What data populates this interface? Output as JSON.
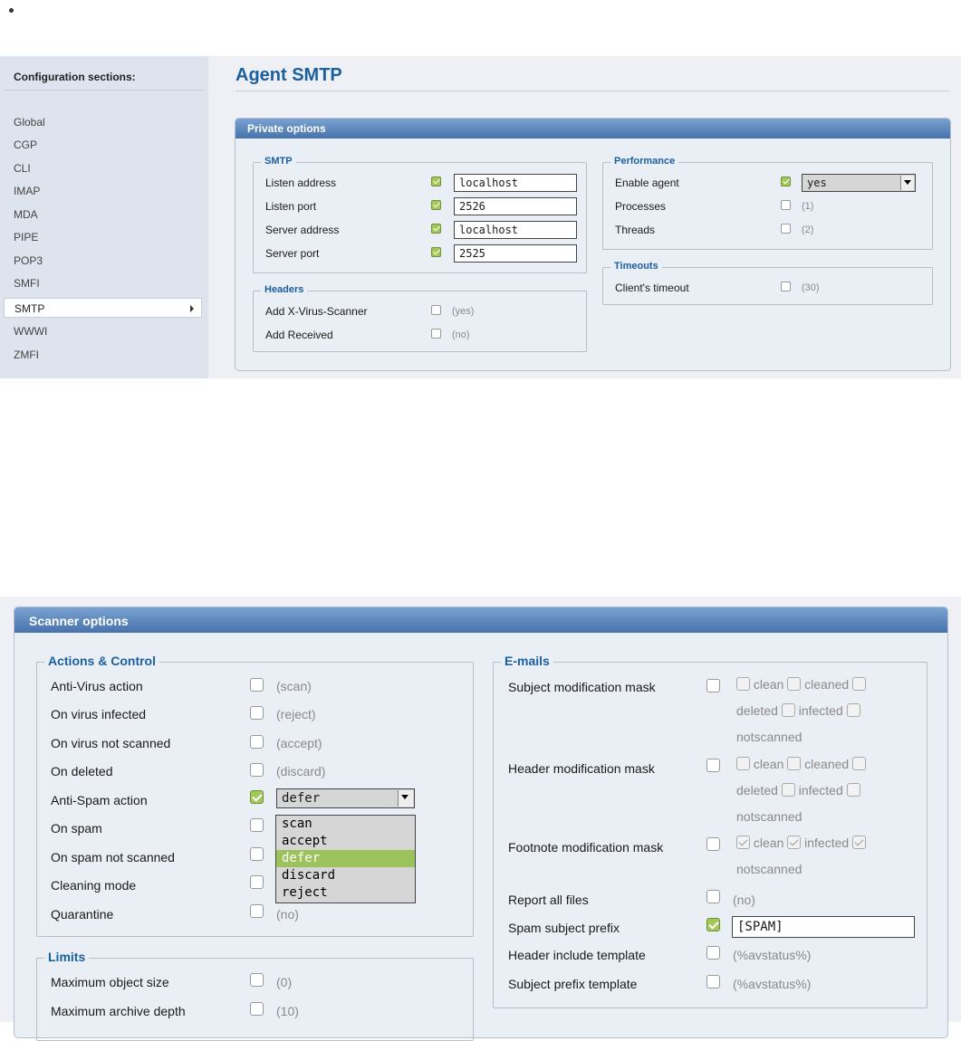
{
  "sidebar": {
    "title": "Configuration sections:",
    "items": [
      "Global",
      "CGP",
      "CLI",
      "IMAP",
      "MDA",
      "PIPE",
      "POP3",
      "SMFI",
      "SMTP",
      "WWWI",
      "ZMFI"
    ],
    "active": "SMTP"
  },
  "page_title": "Agent SMTP",
  "private": {
    "header": "Private options",
    "smtp": {
      "legend": "SMTP",
      "rows": [
        {
          "label": "Listen address",
          "value": "localhost"
        },
        {
          "label": "Listen port",
          "value": "2526"
        },
        {
          "label": "Server address",
          "value": "localhost"
        },
        {
          "label": "Server port",
          "value": "2525"
        }
      ]
    },
    "headers": {
      "legend": "Headers",
      "rows": [
        {
          "label": "Add X-Virus-Scanner",
          "default": "(yes)"
        },
        {
          "label": "Add Received",
          "default": "(no)"
        }
      ]
    },
    "performance": {
      "legend": "Performance",
      "enable_agent": {
        "label": "Enable agent",
        "value": "yes"
      },
      "processes": {
        "label": "Processes",
        "default": "(1)"
      },
      "threads": {
        "label": "Threads",
        "default": "(2)"
      }
    },
    "timeouts": {
      "legend": "Timeouts",
      "client_timeout": {
        "label": "Client's timeout",
        "default": "(30)"
      }
    }
  },
  "scanner": {
    "header": "Scanner options",
    "actions": {
      "legend": "Actions & Control",
      "rows": [
        {
          "label": "Anti-Virus action",
          "default": "(scan)"
        },
        {
          "label": "On virus infected",
          "default": "(reject)"
        },
        {
          "label": "On virus not scanned",
          "default": "(accept)"
        },
        {
          "label": "On deleted",
          "default": "(discard)"
        },
        {
          "label": "Anti-Spam action",
          "value": "defer"
        },
        {
          "label": "On spam",
          "default": ""
        },
        {
          "label": "On spam not scanned",
          "default": ""
        },
        {
          "label": "Cleaning mode",
          "default": ""
        },
        {
          "label": "Quarantine",
          "default": "(no)"
        }
      ],
      "dropdown_options": [
        "scan",
        "accept",
        "defer",
        "discard",
        "reject"
      ],
      "dropdown_highlight": "defer"
    },
    "limits": {
      "legend": "Limits",
      "rows": [
        {
          "label": "Maximum object size",
          "default": "(0)"
        },
        {
          "label": "Maximum archive depth",
          "default": "(10)"
        }
      ]
    },
    "emails": {
      "legend": "E-mails",
      "subject_mask": {
        "label": "Subject modification mask",
        "w1": "clean",
        "w2": "cleaned",
        "w3": "deleted",
        "w4": "infected",
        "w5": "notscanned"
      },
      "header_mask": {
        "label": "Header modification mask",
        "w1": "clean",
        "w2": "cleaned",
        "w3": "deleted",
        "w4": "infected",
        "w5": "notscanned"
      },
      "footnote_mask": {
        "label": "Footnote modification mask",
        "w1": "clean",
        "w2": "infected",
        "w3": "notscanned"
      },
      "report_all_files": {
        "label": "Report all files",
        "default": "(no)"
      },
      "spam_prefix": {
        "label": "Spam subject prefix",
        "value": "[SPAM]"
      },
      "header_template": {
        "label": "Header include template",
        "default": "(%avstatus%)"
      },
      "subject_template": {
        "label": "Subject prefix template",
        "default": "(%avstatus%)"
      }
    }
  }
}
